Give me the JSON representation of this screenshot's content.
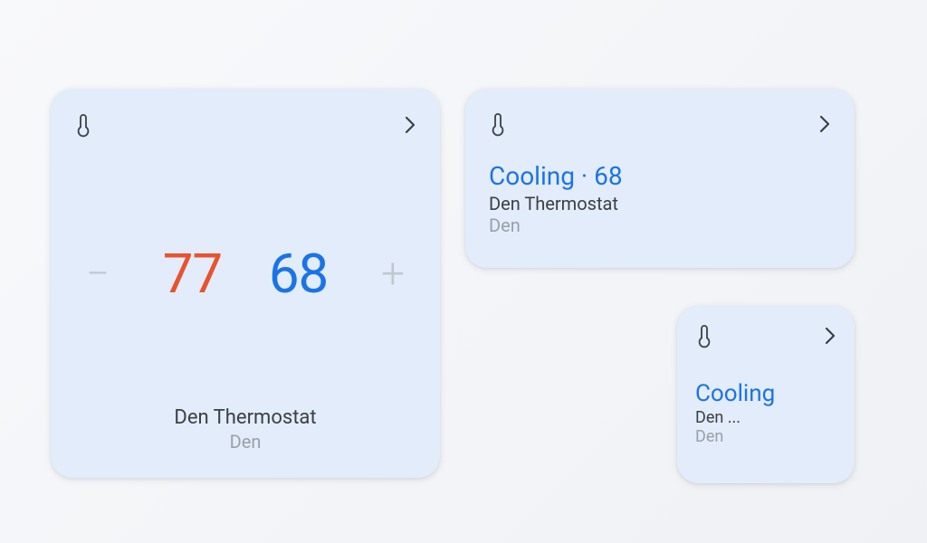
{
  "large": {
    "heat_temp": "77",
    "cool_temp": "68",
    "device_name": "Den Thermostat",
    "room": "Den"
  },
  "medium": {
    "status": "Cooling · 68",
    "device_name": "Den Thermostat",
    "room": "Den"
  },
  "small": {
    "status": "Cooling",
    "device_name": "Den ...",
    "room": "Den"
  }
}
